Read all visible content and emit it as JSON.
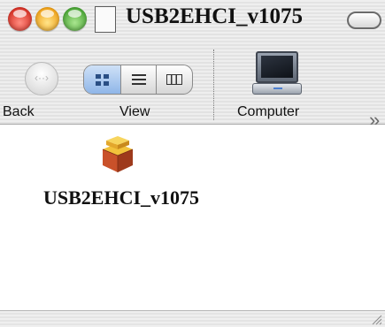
{
  "window": {
    "title": "USB2EHCI_v1075"
  },
  "title_bar": {
    "close_button": "close-icon",
    "minimize_button": "minimize-icon",
    "zoom_button": "zoom-icon",
    "proxy_icon": "document-icon",
    "toolbar_toggle": "toolbar-toggle-icon"
  },
  "toolbar": {
    "back_label": "Back",
    "view_label": "View",
    "computer_label": "Computer",
    "view_modes": [
      "icon-view-icon",
      "list-view-icon",
      "column-view-icon"
    ],
    "selected_view": "icon-view-icon",
    "overflow_glyph": "»",
    "back_glyph": "‹··›"
  },
  "content": {
    "items": [
      {
        "label": "USB2EHCI_v1075",
        "icon": "package-icon"
      }
    ]
  },
  "colors": {
    "close": "#d8362b",
    "minimize": "#f0a41e",
    "zoom": "#4fa83a",
    "selected_view": "#8fb6e8",
    "package_box": "#c9512a",
    "package_top": "#f2c23b"
  }
}
